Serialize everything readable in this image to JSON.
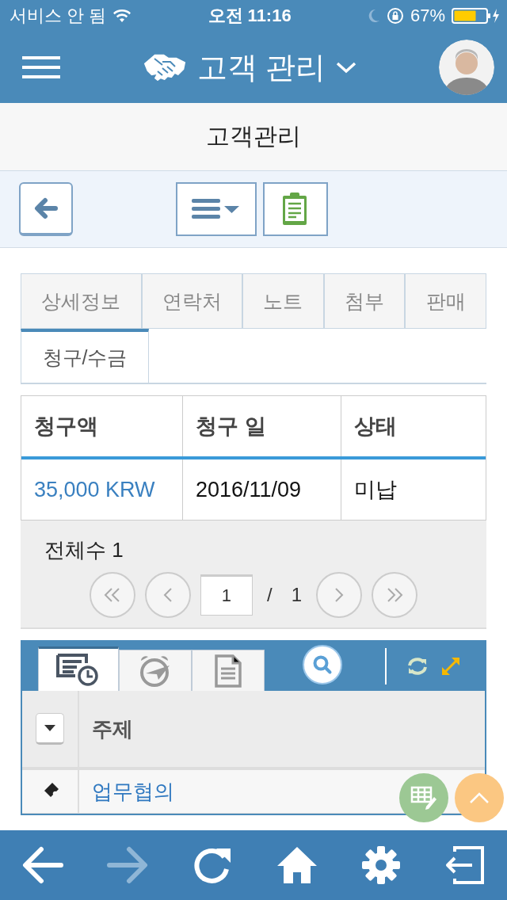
{
  "status_bar": {
    "carrier": "서비스 안 됨",
    "time": "오전 11:16",
    "battery": "67%"
  },
  "header": {
    "title": "고객 관리"
  },
  "page_title": "고객관리",
  "tabs": [
    {
      "label": "상세정보",
      "selected": false
    },
    {
      "label": "연락처",
      "selected": false
    },
    {
      "label": "노트",
      "selected": false
    },
    {
      "label": "첨부",
      "selected": false
    },
    {
      "label": "판매",
      "selected": false
    },
    {
      "label": "청구/수금",
      "selected": true
    }
  ],
  "billing_table": {
    "columns": [
      "청구액",
      "청구 일",
      "상태"
    ],
    "rows": [
      [
        "35,000 KRW",
        "2016/11/09",
        "미납"
      ]
    ]
  },
  "pager": {
    "total": "전체수 1",
    "page": "1",
    "separator": "/",
    "pages": "1"
  },
  "activity_panel": {
    "tabs": [
      {
        "kind": "history",
        "selected": true
      },
      {
        "kind": "reminder",
        "selected": false
      },
      {
        "kind": "document",
        "selected": false
      }
    ],
    "column": "주제",
    "rows": [
      "업무협의"
    ]
  }
}
